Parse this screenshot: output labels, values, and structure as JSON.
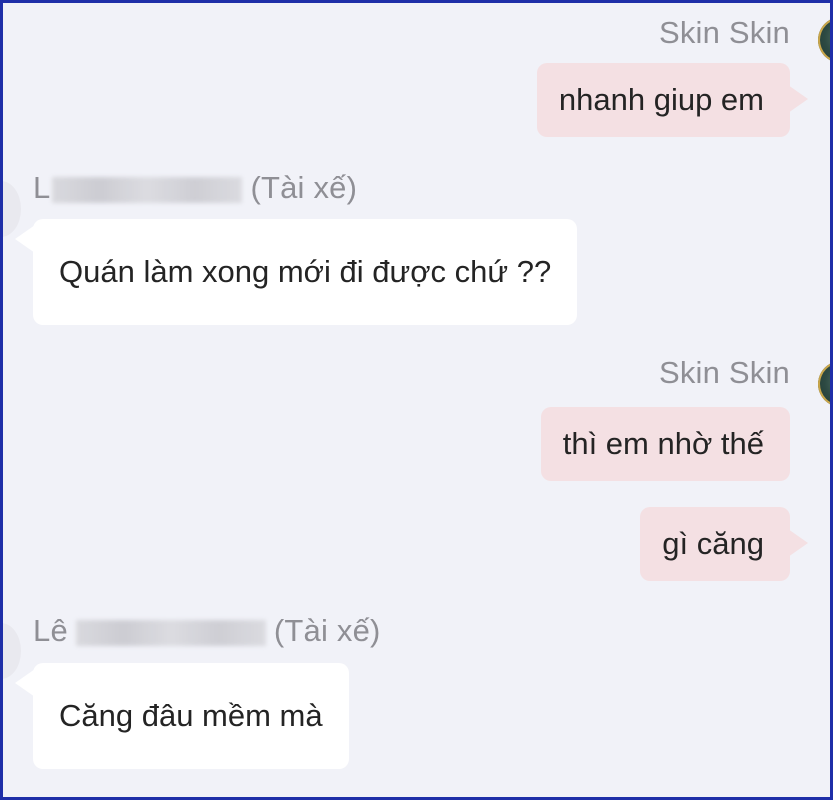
{
  "messages": [
    {
      "sender": "Skin Skin",
      "text": "nhanh giup em"
    },
    {
      "sender_prefix": "L",
      "sender_suffix": "(Tài xế)",
      "text": "Quán làm xong mới đi được chứ ??"
    },
    {
      "sender": "Skin Skin",
      "text": "thì em nhờ thế"
    },
    {
      "text": "gì căng"
    },
    {
      "sender_prefix": "Lê",
      "sender_suffix": "(Tài xế)",
      "text": "Căng đâu mềm mà"
    }
  ],
  "colors": {
    "background": "#f1f2f8",
    "outgoing_bubble": "#f4e0e3",
    "incoming_bubble": "#ffffff",
    "sender_text": "#8f8f95",
    "frame_border": "#1f2fa8"
  },
  "icons": {
    "avatar_right": "avatar",
    "avatar_left": "avatar"
  }
}
